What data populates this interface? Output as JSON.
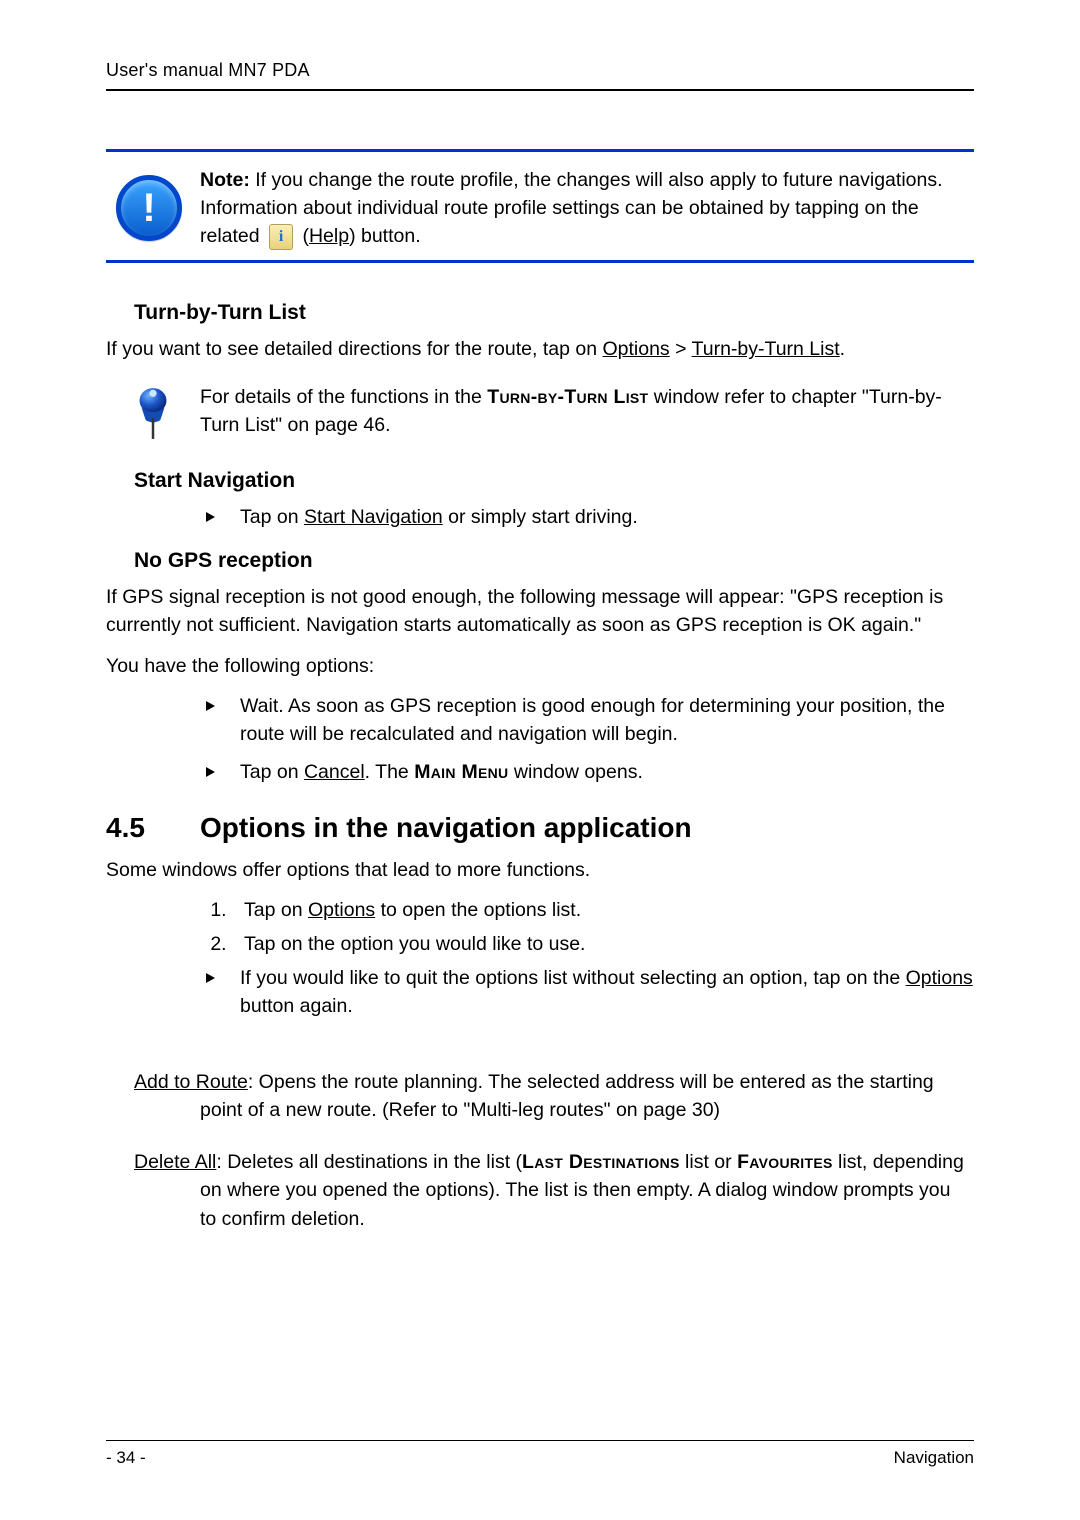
{
  "header": {
    "title": "User's manual MN7 PDA"
  },
  "note_box": {
    "note_label": "Note:",
    "line1_rest": " If you change the route profile, the changes will also apply to future navigations.",
    "line2_a": "Information about individual route profile settings can be obtained by tapping on the related ",
    "help_label": "Help",
    "line2_c": ") button."
  },
  "sec_turn": {
    "heading": "Turn-by-Turn List",
    "para_a": "If you want to see detailed directions for the route, tap on ",
    "options_label": "Options",
    "gt": " > ",
    "tbt_label": "Turn-by-Turn List",
    "dot": ".",
    "pin_a": "For details of the functions in the ",
    "pin_sc1": "Turn-by-Turn List",
    "pin_b": " window refer to chapter \"Turn-by-Turn List\" on page 46."
  },
  "sec_start": {
    "heading": "Start Navigation",
    "item_a": "Tap on ",
    "item_u": "Start Navigation",
    "item_b": " or simply start driving."
  },
  "sec_gps": {
    "heading": "No GPS reception",
    "para1": "If GPS signal reception is not good enough, the following message will appear: \"GPS reception is currently not sufficient. Navigation starts automatically as soon as GPS reception is OK again.\"",
    "para2": "You have the following options:",
    "bullet1": "Wait. As soon as GPS reception is good enough for determining your position, the route will be recalculated and navigation will begin.",
    "bullet2_a": "Tap on ",
    "bullet2_u": "Cancel",
    "bullet2_b": ". The ",
    "bullet2_sc": "Main Menu",
    "bullet2_c": " window opens."
  },
  "sec_45": {
    "num": "4.5",
    "title": "Options in the navigation application",
    "intro": "Some windows offer options that lead to more functions.",
    "step1_a": "Tap on ",
    "step1_u": "Options",
    "step1_b": " to open the options list.",
    "step2": "Tap on the option you would like to use.",
    "bullet_a": "If you would like to quit the options list without selecting an option, tap on the ",
    "bullet_u": "Options",
    "bullet_b": " button again."
  },
  "defs": {
    "add_label": "Add to Route",
    "add_body": ": Opens the route planning. The selected address will be entered as the starting point of a new route. (Refer to \"Multi-leg routes\" on page 30)",
    "del_label": "Delete All",
    "del_a": ": Deletes all destinations in the list (",
    "del_sc1": "Last Destinations",
    "del_b": " list or ",
    "del_sc2": "Favourites",
    "del_c": " list, depending on where you opened the options). The list is then empty. A dialog window prompts you to confirm deletion."
  },
  "footer": {
    "page": "- 34 -",
    "section": "Navigation"
  }
}
